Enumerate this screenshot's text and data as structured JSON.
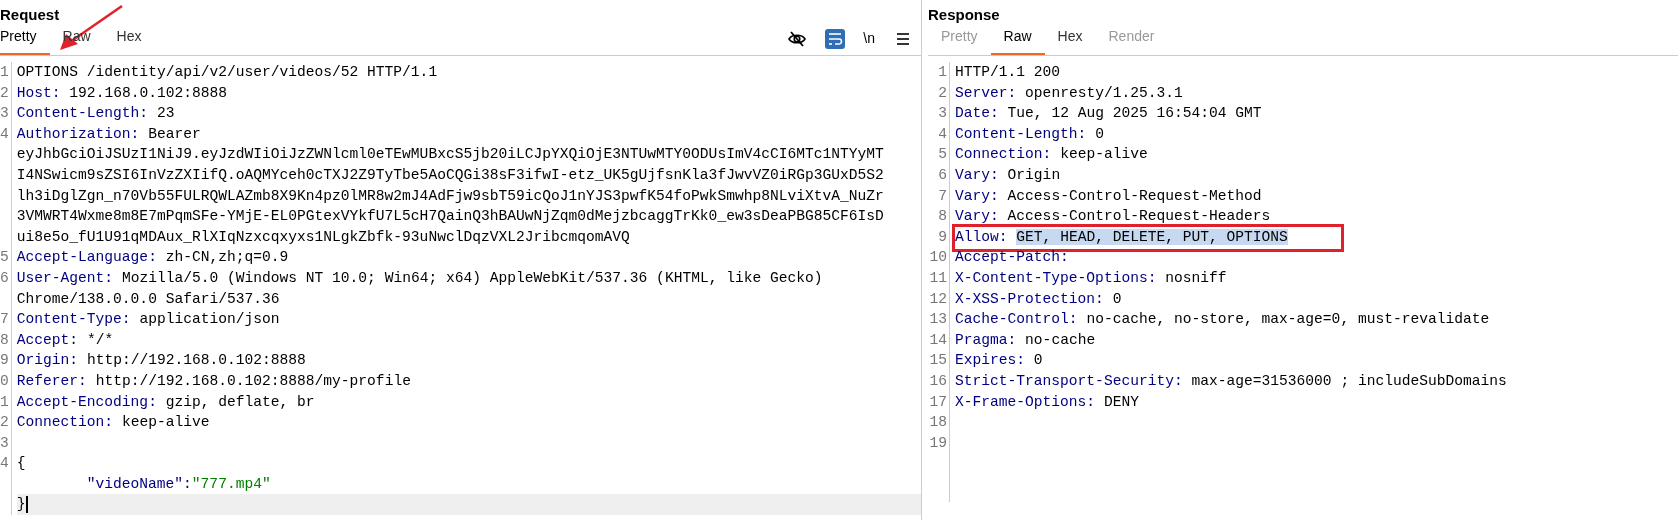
{
  "request": {
    "title": "Request",
    "tabs": [
      {
        "label": "Pretty",
        "selected": true,
        "disabled": false
      },
      {
        "label": "Raw",
        "selected": false,
        "disabled": false
      },
      {
        "label": "Hex",
        "selected": false,
        "disabled": false
      }
    ],
    "toolbar": {
      "wrap_on": true,
      "newline_label": "\\n"
    },
    "lines": [
      {
        "kind": "start",
        "number": "1",
        "text": "OPTIONS /identity/api/v2/user/videos/52 HTTP/1.1",
        "current": false
      },
      {
        "kind": "header",
        "number": "2",
        "name": "Host:",
        "value": "192.168.0.102:8888",
        "current": false
      },
      {
        "kind": "header",
        "number": "3",
        "name": "Content-Length:",
        "value": "23",
        "current": false
      },
      {
        "kind": "header",
        "number": "4",
        "name": "Authorization:",
        "value": "Bearer",
        "current": false
      },
      {
        "kind": "wrap",
        "text": "eyJhbGciOiJSUzI1NiJ9.eyJzdWIiOiJzZWNlcml0eTEwMUBxcS5jb20iLCJpYXQiOjE3NTUwMTY0ODUsImV4cCI6MTc1NTYyMT",
        "current": false
      },
      {
        "kind": "wrap",
        "text": "I4NSwicm9sZSI6InVzZXIifQ.oAQMYceh0cTXJ2Z9TyTbe5AoCQGi38sF3ifwI-etz_UK5gUjfsnKla3fJwvVZ0iRGp3GUxD5S2",
        "current": false
      },
      {
        "kind": "wrap",
        "text": "lh3iDglZgn_n70Vb55FULRQWLAZmb8X9Kn4pz0lMR8w2mJ4AdFjw9sbT59icQoJ1nYJS3pwfK54foPwkSmwhp8NLviXtvA_NuZr",
        "current": false
      },
      {
        "kind": "wrap",
        "text": "3VMWRT4Wxme8m8E7mPqmSFe-YMjE-EL0PGtexVYkfU7L5cH7QainQ3hBAUwNjZqm0dMejzbcaggTrKk0_ew3sDeaPBG85CF6IsD",
        "current": false
      },
      {
        "kind": "wrap",
        "text": "ui8e5o_fU1U91qMDAux_RlXIqNzxcqxyxs1NLgkZbfk-93uNwclDqzVXL2JribcmqomAVQ",
        "current": false
      },
      {
        "kind": "header",
        "number": "5",
        "name": "Accept-Language:",
        "value": "zh-CN,zh;q=0.9",
        "current": false
      },
      {
        "kind": "header",
        "number": "6",
        "name": "User-Agent:",
        "value": "Mozilla/5.0 (Windows NT 10.0; Win64; x64) AppleWebKit/537.36 (KHTML, like Gecko)",
        "current": false
      },
      {
        "kind": "wrap",
        "text": "Chrome/138.0.0.0 Safari/537.36",
        "current": false
      },
      {
        "kind": "header",
        "number": "7",
        "name": "Content-Type:",
        "value": "application/json",
        "current": false
      },
      {
        "kind": "header",
        "number": "8",
        "name": "Accept:",
        "value": "*/*",
        "current": false
      },
      {
        "kind": "header",
        "number": "9",
        "name": "Origin:",
        "value": "http://192.168.0.102:8888",
        "current": false
      },
      {
        "kind": "header",
        "number": "0",
        "name": "Referer:",
        "value": "http://192.168.0.102:8888/my-profile",
        "current": false
      },
      {
        "kind": "header",
        "number": "1",
        "name": "Accept-Encoding:",
        "value": "gzip, deflate, br",
        "current": false
      },
      {
        "kind": "header",
        "number": "2",
        "name": "Connection:",
        "value": "keep-alive",
        "current": false
      },
      {
        "kind": "blank",
        "number": "3",
        "current": false
      },
      {
        "kind": "brace",
        "number": "4",
        "text": "{",
        "current": false
      },
      {
        "kind": "pair",
        "key": "\"videoName\":",
        "value": "\"777.mp4\"",
        "current": false
      },
      {
        "kind": "brace",
        "text": "}",
        "current": true
      }
    ]
  },
  "response": {
    "title": "Response",
    "tabs": [
      {
        "label": "Pretty",
        "selected": false,
        "disabled": true
      },
      {
        "label": "Raw",
        "selected": true,
        "disabled": false
      },
      {
        "label": "Hex",
        "selected": false,
        "disabled": false
      },
      {
        "label": "Render",
        "selected": false,
        "disabled": true
      }
    ],
    "lines": [
      {
        "kind": "start",
        "number": "1",
        "text": "HTTP/1.1 200",
        "highlighted": false,
        "boxed": false
      },
      {
        "kind": "header",
        "number": "2",
        "name": "Server:",
        "value": "openresty/1.25.3.1",
        "highlighted": false,
        "boxed": false
      },
      {
        "kind": "header",
        "number": "3",
        "name": "Date:",
        "value": "Tue, 12 Aug 2025 16:54:04 GMT",
        "highlighted": false,
        "boxed": false
      },
      {
        "kind": "header",
        "number": "4",
        "name": "Content-Length:",
        "value": "0",
        "highlighted": false,
        "boxed": false
      },
      {
        "kind": "header",
        "number": "5",
        "name": "Connection:",
        "value": "keep-alive",
        "highlighted": false,
        "boxed": false
      },
      {
        "kind": "header",
        "number": "6",
        "name": "Vary:",
        "value": "Origin",
        "highlighted": false,
        "boxed": false
      },
      {
        "kind": "header",
        "number": "7",
        "name": "Vary:",
        "value": "Access-Control-Request-Method",
        "highlighted": false,
        "boxed": false
      },
      {
        "kind": "header",
        "number": "8",
        "name": "Vary:",
        "value": "Access-Control-Request-Headers",
        "highlighted": false,
        "boxed": false
      },
      {
        "kind": "header",
        "number": "9",
        "name": "Allow:",
        "value": "GET, HEAD, DELETE, PUT, OPTIONS",
        "highlighted": true,
        "boxed": true
      },
      {
        "kind": "header",
        "number": "10",
        "name": "Accept-Patch:",
        "highlighted": false,
        "boxed": false
      },
      {
        "kind": "header",
        "number": "11",
        "name": "X-Content-Type-Options:",
        "value": "nosniff",
        "highlighted": false,
        "boxed": false
      },
      {
        "kind": "header",
        "number": "12",
        "name": "X-XSS-Protection:",
        "value": "0",
        "highlighted": false,
        "boxed": false
      },
      {
        "kind": "header",
        "number": "13",
        "name": "Cache-Control:",
        "value": "no-cache, no-store, max-age=0, must-revalidate",
        "highlighted": false,
        "boxed": false
      },
      {
        "kind": "header",
        "number": "14",
        "name": "Pragma:",
        "value": "no-cache",
        "highlighted": false,
        "boxed": false
      },
      {
        "kind": "header",
        "number": "15",
        "name": "Expires:",
        "value": "0",
        "highlighted": false,
        "boxed": false
      },
      {
        "kind": "header",
        "number": "16",
        "name": "Strict-Transport-Security:",
        "value": "max-age=31536000 ; includeSubDomains",
        "highlighted": false,
        "boxed": false
      },
      {
        "kind": "header",
        "number": "17",
        "name": "X-Frame-Options:",
        "value": "DENY",
        "highlighted": false,
        "boxed": false
      },
      {
        "kind": "blank",
        "number": "18",
        "highlighted": false,
        "boxed": false
      },
      {
        "kind": "blank",
        "number": "19",
        "highlighted": false,
        "boxed": false
      }
    ]
  }
}
